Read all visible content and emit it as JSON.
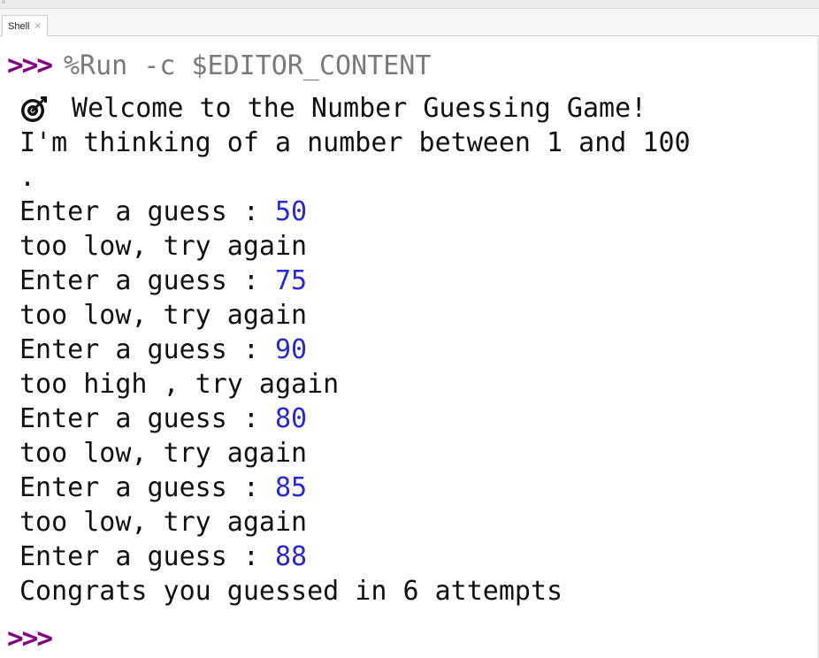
{
  "tabs": [
    {
      "label": "Shell",
      "close_glyph": "×"
    }
  ],
  "prompt_symbol": ">>>",
  "command": "%Run -c $EDITOR_CONTENT",
  "output": {
    "welcome_icon": "target-icon",
    "welcome": "Welcome to the Number Guessing Game!",
    "thinking": "I'm thinking of a number between 1 and 100",
    "thinking_wrap": ".",
    "rounds": [
      {
        "prompt": "Enter a guess : ",
        "guess": "50",
        "feedback": "too low, try again"
      },
      {
        "prompt": "Enter a guess : ",
        "guess": "75",
        "feedback": "too low, try again"
      },
      {
        "prompt": "Enter a guess : ",
        "guess": "90",
        "feedback": "too high , try again"
      },
      {
        "prompt": "Enter a guess : ",
        "guess": "80",
        "feedback": "too low, try again"
      },
      {
        "prompt": "Enter a guess : ",
        "guess": "85",
        "feedback": "too low, try again"
      },
      {
        "prompt": "Enter a guess : ",
        "guess": "88"
      }
    ],
    "result": "Congrats you guessed in 6 attempts"
  },
  "colors": {
    "prompt": "#800080",
    "command": "#7a7a7a",
    "input_number": "#2a2ac8",
    "text": "#111111"
  }
}
